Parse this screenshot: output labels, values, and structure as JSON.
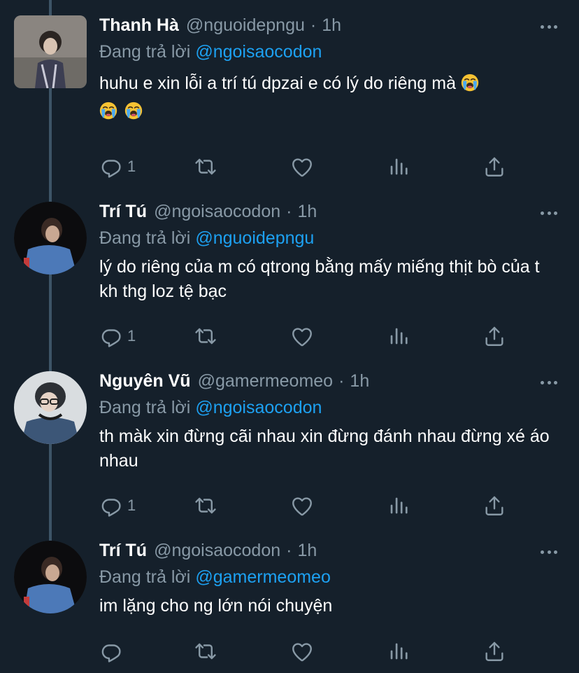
{
  "tweets": [
    {
      "name": "Thanh Hà",
      "handle": "@nguoidepngu",
      "time": "1h",
      "reply_prefix": "Đang trả lời",
      "reply_to": "@ngoisaocodon",
      "text": "huhu e xin lỗi a trí tú dpzai e có lý do riêng mà",
      "emoji": "loudly-crying-face",
      "reply_count": "1"
    },
    {
      "name": "Trí Tú",
      "handle": "@ngoisaocodon",
      "time": "1h",
      "reply_prefix": "Đang trả lời",
      "reply_to": "@nguoidepngu",
      "text": "lý do riêng của m có qtrong bằng mấy miếng thịt bò của t kh thg loz tệ bạc",
      "reply_count": "1"
    },
    {
      "name": "Nguyên Vũ",
      "handle": "@gamermeomeo",
      "time": "1h",
      "reply_prefix": "Đang trả lời",
      "reply_to": "@ngoisaocodon",
      "text": "th màk xin đừng cãi nhau xin đừng đánh nhau đừng xé áo nhau",
      "reply_count": "1"
    },
    {
      "name": "Trí Tú",
      "handle": "@ngoisaocodon",
      "time": "1h",
      "reply_prefix": "Đang trả lời",
      "reply_to": "@gamermeomeo",
      "text": "im lặng cho ng lớn nói chuyện",
      "reply_count": ""
    }
  ],
  "separator": "·",
  "icons": [
    "reply-icon",
    "retweet-icon",
    "like-icon",
    "analytics-icon",
    "share-icon",
    "more-icon"
  ],
  "colors": {
    "background": "#15202b",
    "secondary_text": "#8899a6",
    "link": "#1da1f2",
    "thread_line": "#3d5466"
  }
}
